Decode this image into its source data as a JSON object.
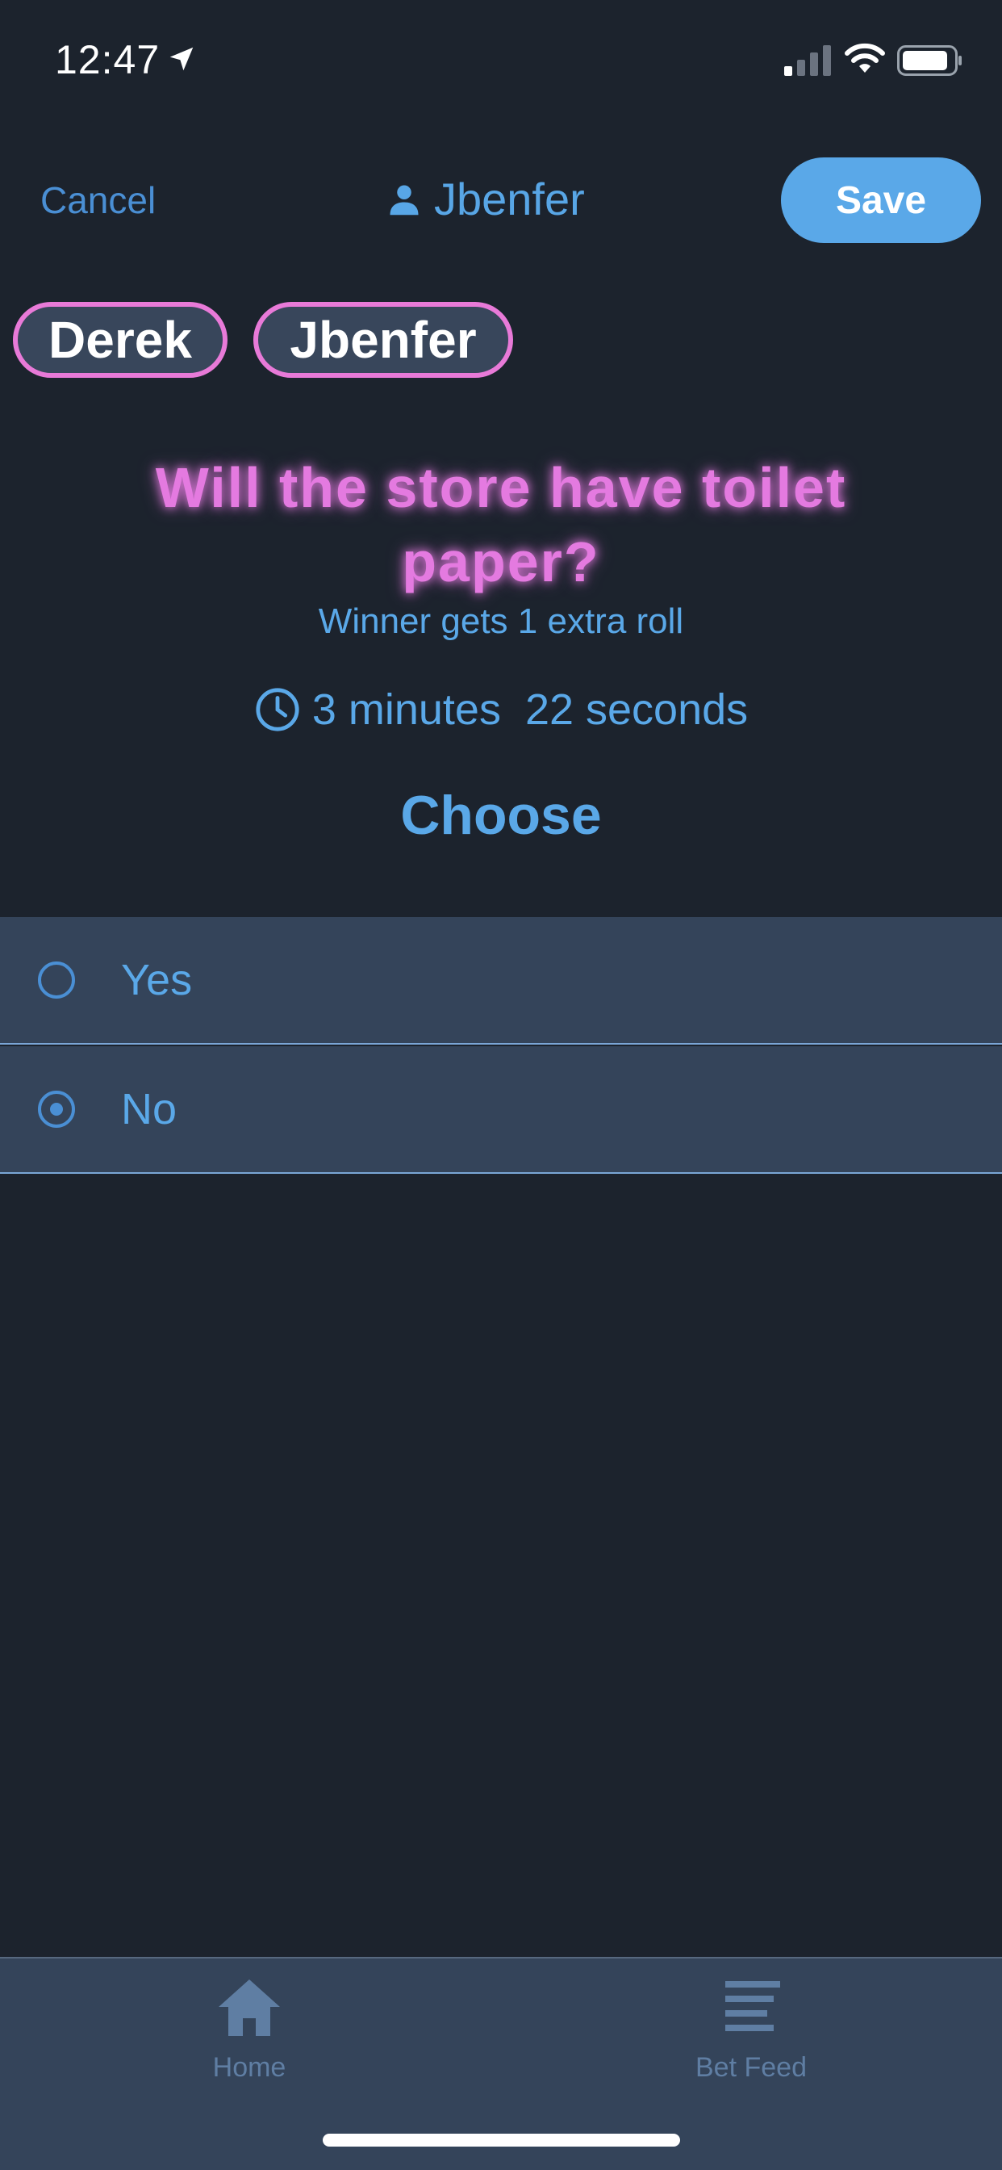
{
  "status_bar": {
    "time": "12:47",
    "icons": [
      "location-arrow-icon",
      "signal-icon",
      "wifi-icon",
      "battery-icon"
    ]
  },
  "header": {
    "cancel_label": "Cancel",
    "user_name": "Jbenfer",
    "save_label": "Save"
  },
  "participants": [
    "Derek",
    "Jbenfer"
  ],
  "bet": {
    "question": "Will the store have toilet paper?",
    "subtitle": "Winner gets 1 extra roll",
    "timer": "3 minutes  22 seconds",
    "choose_label": "Choose",
    "options": [
      {
        "label": "Yes",
        "selected": false
      },
      {
        "label": "No",
        "selected": true
      }
    ]
  },
  "tab_bar": {
    "tabs": [
      {
        "label": "Home",
        "icon": "home-icon"
      },
      {
        "label": "Bet Feed",
        "icon": "feed-icon"
      }
    ]
  },
  "colors": {
    "background": "#1c232d",
    "accent": "#5aa8e8",
    "question_glow": "#e47ae0",
    "pill_border": "#e87ad8",
    "panel": "#34445a"
  }
}
